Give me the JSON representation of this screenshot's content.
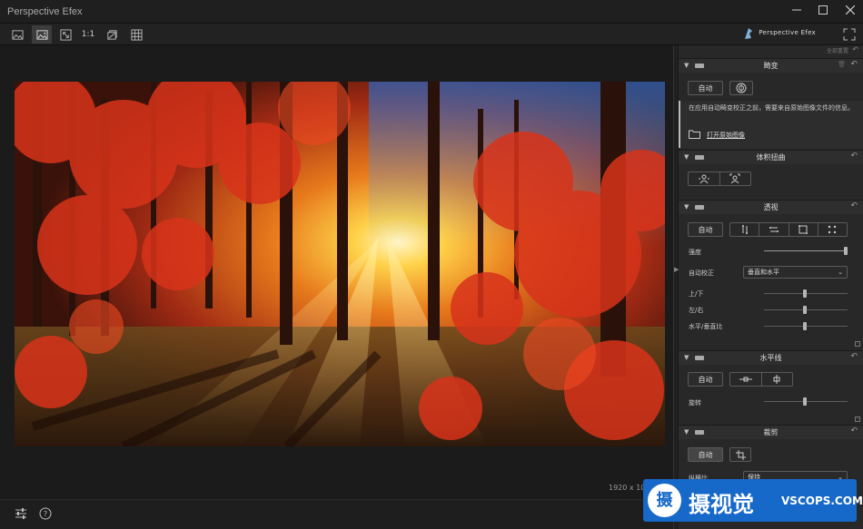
{
  "window": {
    "title": "Perspective Efex"
  },
  "toolbar": {
    "zoom_label": "1:1",
    "brand": "Perspective Efex"
  },
  "canvas": {
    "image_size": "1920 x 10"
  },
  "panel": {
    "reset_all": "全部重置",
    "distortion": {
      "title": "畸变",
      "auto_label": "自动",
      "info_text": "在应用自动畸变校正之前，需要来自原始图像文件的信息。",
      "open_raw": "打开原始图像"
    },
    "volume": {
      "title": "体积扭曲"
    },
    "perspective": {
      "title": "透视",
      "auto_label": "自动",
      "strength_label": "强度",
      "strength_value": 1.0,
      "auto_correct_label": "自动校正",
      "auto_correct_value": "垂直和水平",
      "up_down_label": "上/下",
      "left_right_label": "左/右",
      "ratio_label": "水平/垂直比"
    },
    "horizon": {
      "title": "水平线",
      "auto_label": "自动",
      "rotate_label": "旋转"
    },
    "crop": {
      "title": "裁剪",
      "auto_label": "自动",
      "aspect_label": "纵横比",
      "aspect_value": "保持"
    }
  },
  "watermark": {
    "cn": "摄视觉",
    "en": "VSCOPS.COM",
    "logo": "摄"
  }
}
